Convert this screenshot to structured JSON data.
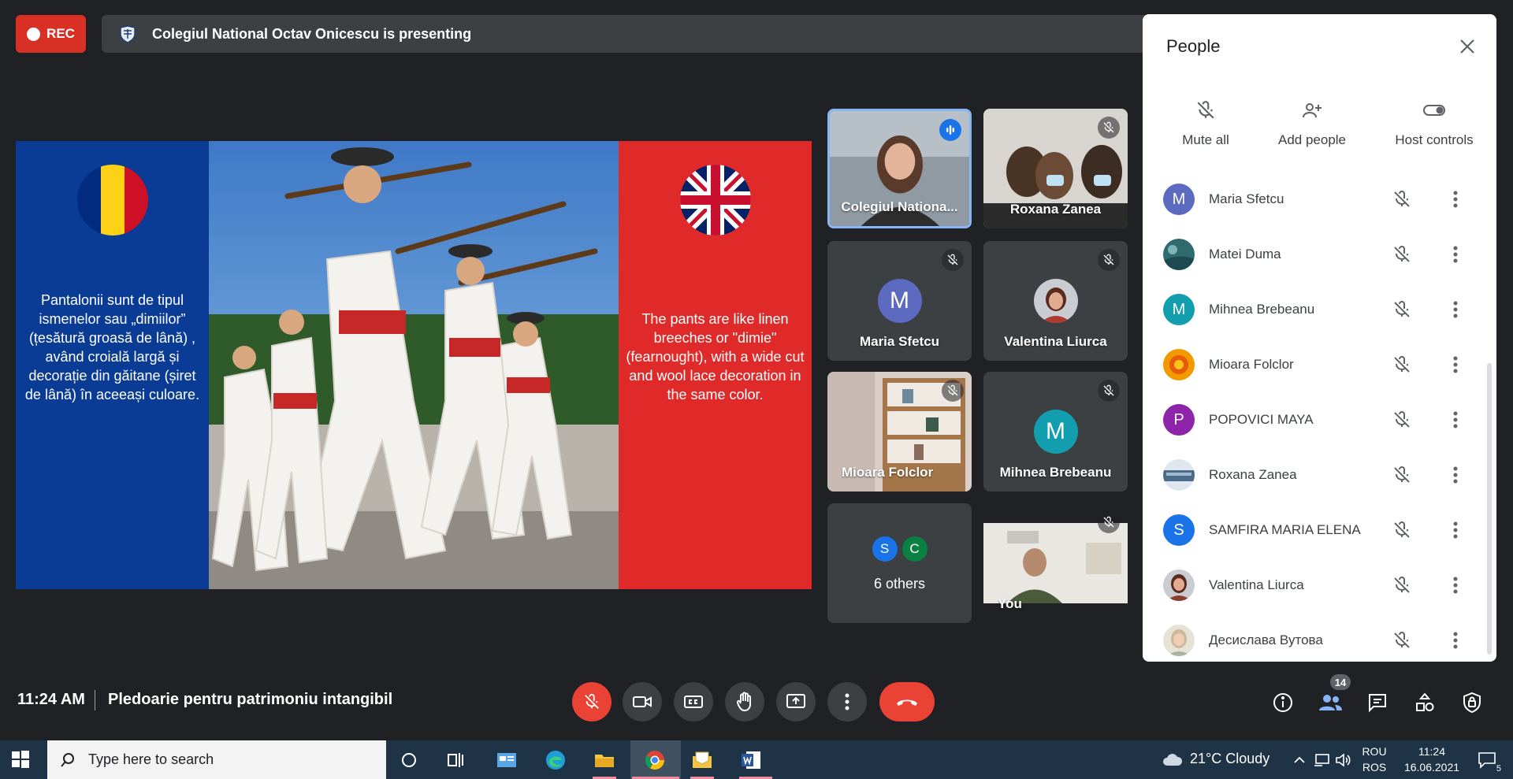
{
  "recording": {
    "label": "REC"
  },
  "presenting_banner": {
    "text": "Colegiul National Octav Onicescu is presenting"
  },
  "slide": {
    "left_text": "Pantalonii sunt de tipul ismenelor sau „dimiilor” (țesătură groasă de lână) , având croială largă și decorație din găitane (șiret de lână) în aceeași culoare.",
    "right_text": "The pants are like linen breeches or \"dimie\" (fearnought), with a wide cut and wool lace decoration in the same color.",
    "colors": {
      "blue": "#0a3c95",
      "red": "#e02a2a"
    }
  },
  "tiles": [
    {
      "name": "Colegiul Nationa...",
      "state": "speaking",
      "kind": "video"
    },
    {
      "name": "Roxana Zanea",
      "state": "muted",
      "kind": "video"
    },
    {
      "name": "Maria Sfetcu",
      "state": "muted",
      "kind": "avatar",
      "initial": "M",
      "color": "#5c6bc0"
    },
    {
      "name": "Valentina Liurca",
      "state": "muted",
      "kind": "photo"
    },
    {
      "name": "Mioara Folclor",
      "state": "muted",
      "kind": "video"
    },
    {
      "name": "Mihnea Brebeanu",
      "state": "muted",
      "kind": "avatar",
      "initial": "M",
      "color": "#129eaf"
    },
    {
      "name": "6 others",
      "kind": "others",
      "avatars": [
        {
          "initial": "S",
          "color": "#1a73e8"
        },
        {
          "initial": "C",
          "color": "#0b8043"
        }
      ]
    },
    {
      "name": "You",
      "state": "muted",
      "kind": "video"
    }
  ],
  "people_panel": {
    "title": "People",
    "actions": [
      {
        "label": "Mute all",
        "icon": "mic-off-icon"
      },
      {
        "label": "Add people",
        "icon": "add-person-icon"
      },
      {
        "label": "Host controls",
        "icon": "toggle-icon"
      }
    ],
    "participants": [
      {
        "name": "Maria Sfetcu",
        "initial": "M",
        "color": "#5c6bc0",
        "avatar": "letter"
      },
      {
        "name": "Matei Duma",
        "initial": "",
        "color": "#2f6b6e",
        "avatar": "photo"
      },
      {
        "name": "Mihnea Brebeanu",
        "initial": "M",
        "color": "#129eaf",
        "avatar": "letter"
      },
      {
        "name": "Mioara Folclor",
        "initial": "",
        "color": "#f29900",
        "avatar": "photo"
      },
      {
        "name": "POPOVICI MAYA",
        "initial": "P",
        "color": "#8e24aa",
        "avatar": "letter"
      },
      {
        "name": "Roxana Zanea",
        "initial": "",
        "color": "#4a6b8a",
        "avatar": "photo"
      },
      {
        "name": "SAMFIRA MARIA ELENA",
        "initial": "S",
        "color": "#1a73e8",
        "avatar": "letter"
      },
      {
        "name": "Valentina Liurca",
        "initial": "",
        "color": "#8d3b2b",
        "avatar": "photo"
      },
      {
        "name": "Десислава Вутова",
        "initial": "",
        "color": "#c9b89a",
        "avatar": "photo"
      }
    ]
  },
  "bottom_bar": {
    "time": "11:24 AM",
    "meeting_name": "Pledoarie pentru patrimoniu intangibil",
    "participant_count": "14"
  },
  "taskbar": {
    "search_placeholder": "Type here to search",
    "weather": "21°C  Cloudy",
    "lang_top": "ROU",
    "lang_bottom": "ROS",
    "clock_time": "11:24",
    "clock_date": "16.06.2021",
    "notifications": "5"
  }
}
